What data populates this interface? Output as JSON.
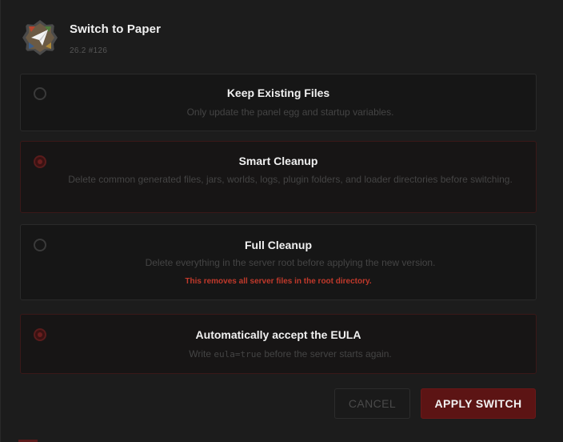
{
  "dialog": {
    "title": "Switch to Paper",
    "version": "26.2 #126",
    "logo_icon": "paper-plane-icon"
  },
  "options": [
    {
      "title": "Keep Existing Files",
      "description": "Only update the panel egg and startup variables.",
      "selected": false
    },
    {
      "title": "Smart Cleanup",
      "description": "Delete common generated files, jars, worlds, logs, plugin folders, and loader directories before switching.",
      "selected": true
    },
    {
      "title": "Full Cleanup",
      "description": "Delete everything in the server root before applying the new version.",
      "warning": "This removes all server files in the root directory.",
      "selected": false
    }
  ],
  "eula": {
    "title": "Automatically accept the EULA",
    "description_prefix": "Write ",
    "description_code": "eula=true",
    "description_suffix": " before the server starts again.",
    "checked": true
  },
  "buttons": {
    "cancel": "CANCEL",
    "apply": "APPLY SWITCH"
  },
  "colors": {
    "accent": "#5c1414",
    "warning": "#c0392b",
    "background": "#1c1c1c"
  }
}
